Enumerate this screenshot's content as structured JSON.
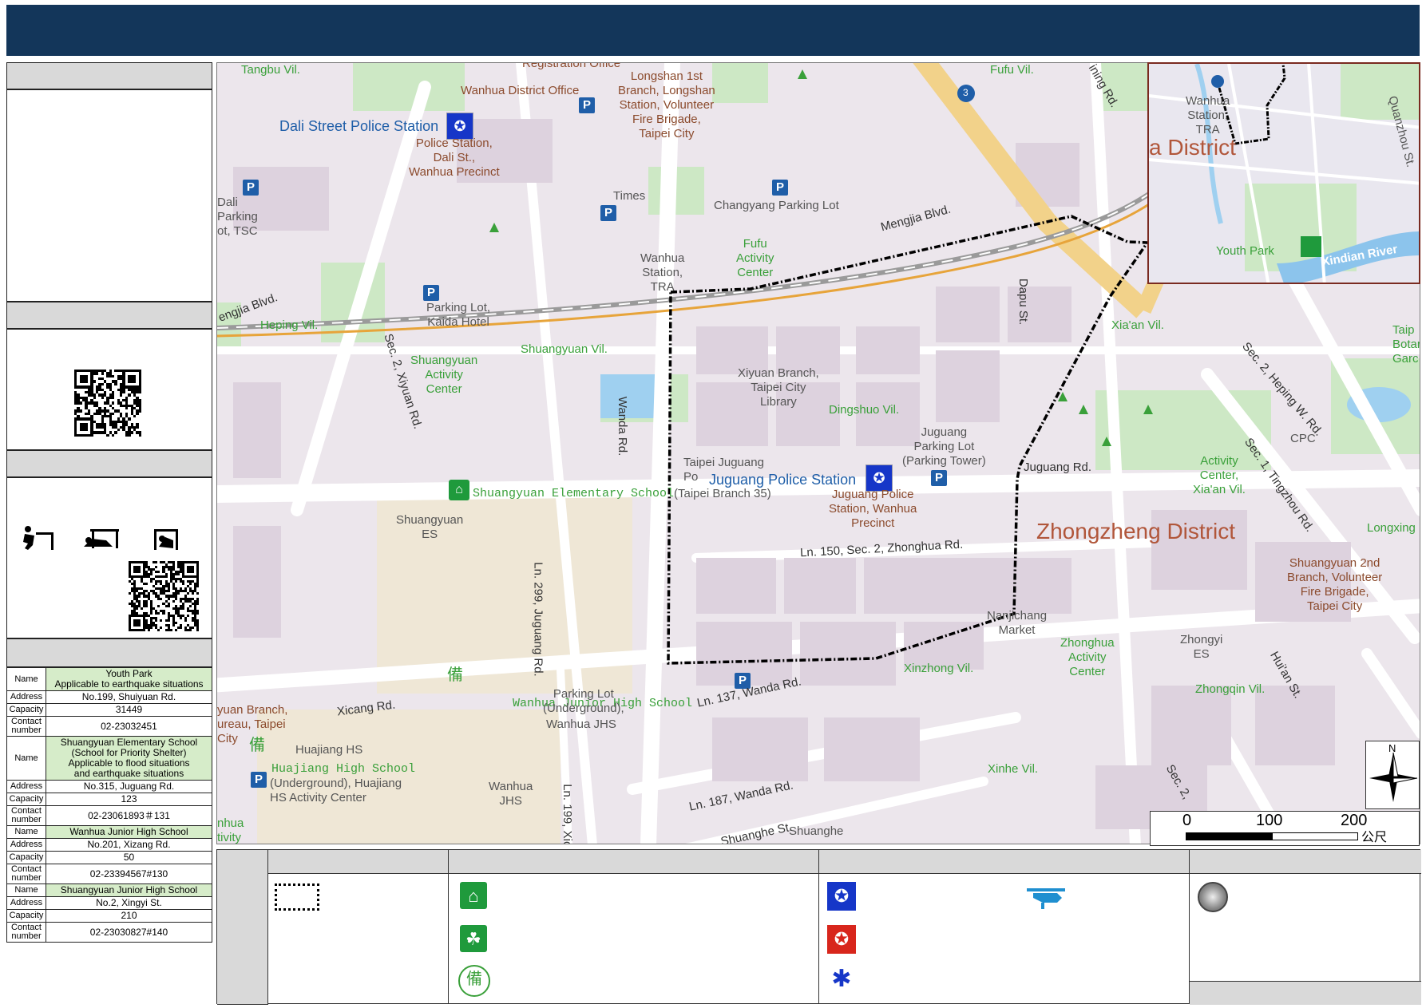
{
  "map": {
    "villages": [
      "Tangbu Vil.",
      "Fufu Vil.",
      "Heping Vil.",
      "Shuangyuan Vil.",
      "Dingshuo Vil.",
      "Xia'an Vil.",
      "Xinzhong Vil.",
      "Zhongqin Vil.",
      "Xinhe Vil."
    ],
    "districts": {
      "zhongzheng": "Zhongzheng District",
      "inset": "a District"
    },
    "roads": {
      "xiyuan": "Sec. 2, Xiyuan Rd.",
      "wanda": "Wanda Rd.",
      "juguang": "Juguang Rd.",
      "zhonghua_lane": "Ln. 150, Sec. 2, Zhonghua Rd.",
      "juguang_lane": "Ln. 299, Juguang Rd.",
      "xicang": "Xicang Rd.",
      "wanda_137": "Ln. 137, Wanda Rd.",
      "wanda_187": "Ln. 187, Wanda Rd.",
      "xicang_199": "Ln. 199, Xica",
      "shuanghe": "Shuanghe St.",
      "dapu": "Dapu St.",
      "mengjia": "Mengjia Blvd.",
      "mengjia_w": "engjia Blvd.",
      "heping": "Sec. 2, Heping W. Rd.",
      "tingzhou": "Sec. 1, Tingzhou Rd.",
      "huian": "Hui'an St.",
      "zhonghua_sec2": "Sec. 2,",
      "ning": "ining Rd.",
      "highway": "3"
    },
    "pois": {
      "dali_police": "Dali Street Police Station",
      "dali_police_desc": "Police Station,\nDali St.,\nWanhua Precinct",
      "wanhua_office": "Wanhua District Office",
      "registration": "Registration Office",
      "longshan": "Longshan 1st\nBranch, Longshan\nStation, Volunteer\nFire Brigade,\nTaipei City",
      "times": "Times",
      "changyang": "Changyang Parking Lot",
      "fufu_center": "Fufu\nActivity\nCenter",
      "wanhua_station": "Wanhua\nStation,\nTRA",
      "dali_parking": "Dali\nParking\not, TSC",
      "kaida": "Parking Lot,\nKaida Hotel",
      "shuangyuan_center": "Shuangyuan\nActivity\nCenter",
      "xiyuan_library": "Xiyuan Branch,\nTaipei City\nLibrary",
      "juguang_parking": "Juguang\nParking Lot\n(Parking Tower)",
      "post": "Taipei Juguang\nPo",
      "juguang_police": "Juguang Police Station",
      "post_branch": "(Taipei Branch 35)",
      "juguang_police_desc": "Juguang Police\nStation, Wanhua\nPrecinct",
      "shuangyuan_school": "Shuangyuan Elementary School",
      "shuangyuan_es": "Shuangyuan\nES",
      "wanhua_jhs_shelter": "Wanhua Junior High School",
      "wanhua_jhs": "Wanhua JHS",
      "wanhua_jhs2": "Wanhua\nJHS",
      "parking_lot_under": "Parking Lot\n(Underground),",
      "huajiang_hs": "Huajiang HS",
      "huajiang_shelter": "Huajiang High School",
      "huajiang_under": "(Underground), Huajiang\nHS Activity Center",
      "branch_left": "yuan Branch,\nureau, Taipei\nCity",
      "nhua": "nhua\ntivity",
      "nanjichang": "Nanjichang\nMarket",
      "zhonghua_center": "Zhonghua\nActivity\nCenter",
      "zhongyi": "Zhongyi\nES",
      "xiaan_center": "Activity\nCenter,\nXia'an Vil.",
      "cpc": "CPC",
      "shuangyuan_fire": "Shuangyuan 2nd\nBranch, Volunteer\nFire Brigade,\nTaipei City",
      "longxing": "Longxing",
      "shuanghe_poi": "Shuanghe",
      "botanical": "Taip\nBotar\nGarc"
    },
    "inset": {
      "station": "Wanhua\nStation,\nTRA",
      "youth_park": "Youth Park",
      "river": "Xindian River",
      "quanzhou": "Quanzhou St."
    },
    "scale": {
      "ticks": [
        "0",
        "100",
        "200"
      ],
      "unit": "公尺"
    },
    "compass": {
      "north": "N"
    }
  },
  "shelters": [
    {
      "name_label": "Name",
      "name": "Youth Park\nApplicable to earthquake situations",
      "address_label": "Address",
      "address": "No.199, Shuiyuan Rd.",
      "capacity_label": "Capacity",
      "capacity": "31449",
      "contact_label": "Contact\nnumber",
      "contact": "02-23032451"
    },
    {
      "name_label": "Name",
      "name": "Shuangyuan Elementary School\n(School for Priority Shelter)\nApplicable to flood situations\nand earthquake situations",
      "address_label": "Address",
      "address": "No.315, Juguang Rd.",
      "capacity_label": "Capacity",
      "capacity": "123",
      "contact_label": "Contact\nnumber",
      "contact": "02-23061893＃131"
    },
    {
      "name_label": "Name",
      "name": "Wanhua Junior High School",
      "address_label": "Address",
      "address": "No.201, Xizang Rd.",
      "capacity_label": "Capacity",
      "capacity": "50",
      "contact_label": "Contact\nnumber",
      "contact": "02-23394567#130"
    },
    {
      "name_label": "Name",
      "name": "Shuangyuan Junior High School",
      "address_label": "Address",
      "address": "No.2, Xingyi St.",
      "capacity_label": "Capacity",
      "capacity": "210",
      "contact_label": "Contact\nnumber",
      "contact": "02-23030827#140"
    }
  ],
  "icons": {
    "legend": [
      "boundary-icon",
      "shelter-icon",
      "activity-center-icon",
      "reserve-icon",
      "police-icon",
      "fire-icon",
      "medical-icon",
      "helicopter-icon",
      "gathering-point-icon"
    ],
    "reserve_glyph": "備",
    "medical_glyph": "✱",
    "police_glyph": "✪",
    "shelter_glyph": "⌂",
    "activity_glyph": "☘"
  },
  "colors": {
    "title_bar": "#13365a",
    "header_gray": "#d9d9d9",
    "table_highlight": "#d6ecc9",
    "boundary": "#000000"
  }
}
